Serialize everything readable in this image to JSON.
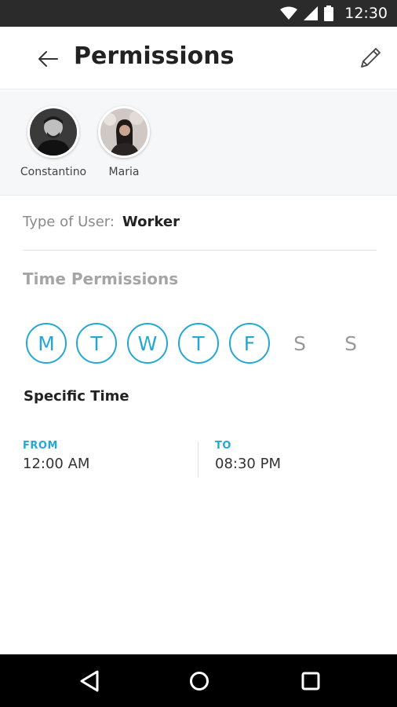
{
  "status_bar": {
    "time": "12:30",
    "icons": [
      "wifi-icon",
      "signal-icon",
      "battery-icon"
    ]
  },
  "header": {
    "title": "Permissions",
    "back_icon": "arrow-left-icon",
    "edit_icon": "pencil-icon"
  },
  "users": [
    {
      "name": "Constantino",
      "avatar": "avatar-photo-man"
    },
    {
      "name": "Maria",
      "avatar": "avatar-photo-woman"
    }
  ],
  "user_type": {
    "label": "Type of User:",
    "value": "Worker"
  },
  "time_permissions": {
    "title": "Time Permissions",
    "days": [
      {
        "letter": "M",
        "selected": true
      },
      {
        "letter": "T",
        "selected": true
      },
      {
        "letter": "W",
        "selected": true
      },
      {
        "letter": "T",
        "selected": true
      },
      {
        "letter": "F",
        "selected": true
      },
      {
        "letter": "S",
        "selected": false
      },
      {
        "letter": "S",
        "selected": false
      }
    ]
  },
  "specific_time": {
    "title": "Specific Time",
    "from_label": "FROM",
    "from_value": "12:00 AM",
    "to_label": "TO",
    "to_value": "08:30 PM"
  },
  "colors": {
    "accent": "#25a7d5",
    "status_bar": "#2b2b2b",
    "nav_bar": "#000000"
  },
  "nav_bar": {
    "icons": [
      "triangle-back-icon",
      "circle-home-icon",
      "square-recents-icon"
    ]
  }
}
